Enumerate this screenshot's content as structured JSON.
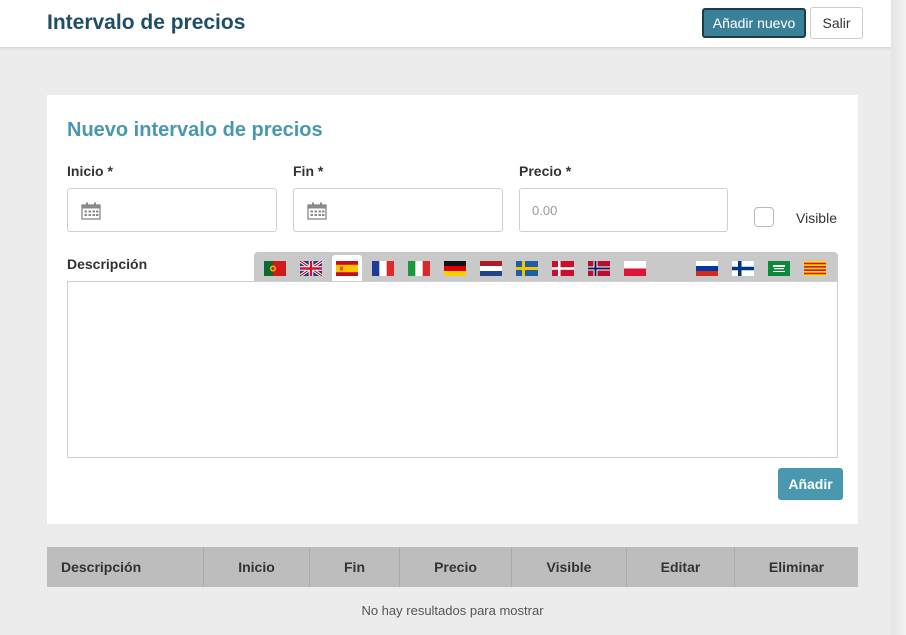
{
  "header": {
    "title": "Intervalo de precios",
    "add_new_label": "Añadir nuevo",
    "exit_label": "Salir"
  },
  "form": {
    "title": "Nuevo intervalo de precios",
    "start_label": "Inicio *",
    "end_label": "Fin *",
    "price_label": "Precio *",
    "price_value": "0.00",
    "visible_label": "Visible",
    "visible_checked": false,
    "description_label": "Descripción",
    "active_language": "es",
    "languages": [
      "pt",
      "en",
      "es",
      "fr",
      "it",
      "de",
      "nl",
      "sv",
      "da",
      "no",
      "pl",
      "ru",
      "fi",
      "ar",
      "ca"
    ],
    "add_label": "Añadir"
  },
  "table": {
    "columns": [
      "Descripción",
      "Inicio",
      "Fin",
      "Precio",
      "Visible",
      "Editar",
      "Eliminar"
    ],
    "empty_text": "No hay resultados para mostrar"
  },
  "colors": {
    "title": "#1f4e66",
    "accent": "#4a98b0",
    "primary_button": "#3b8099",
    "table_header": "#bdbdbd"
  },
  "icons": {
    "start_field": "calendar-icon",
    "end_field": "calendar-icon"
  }
}
